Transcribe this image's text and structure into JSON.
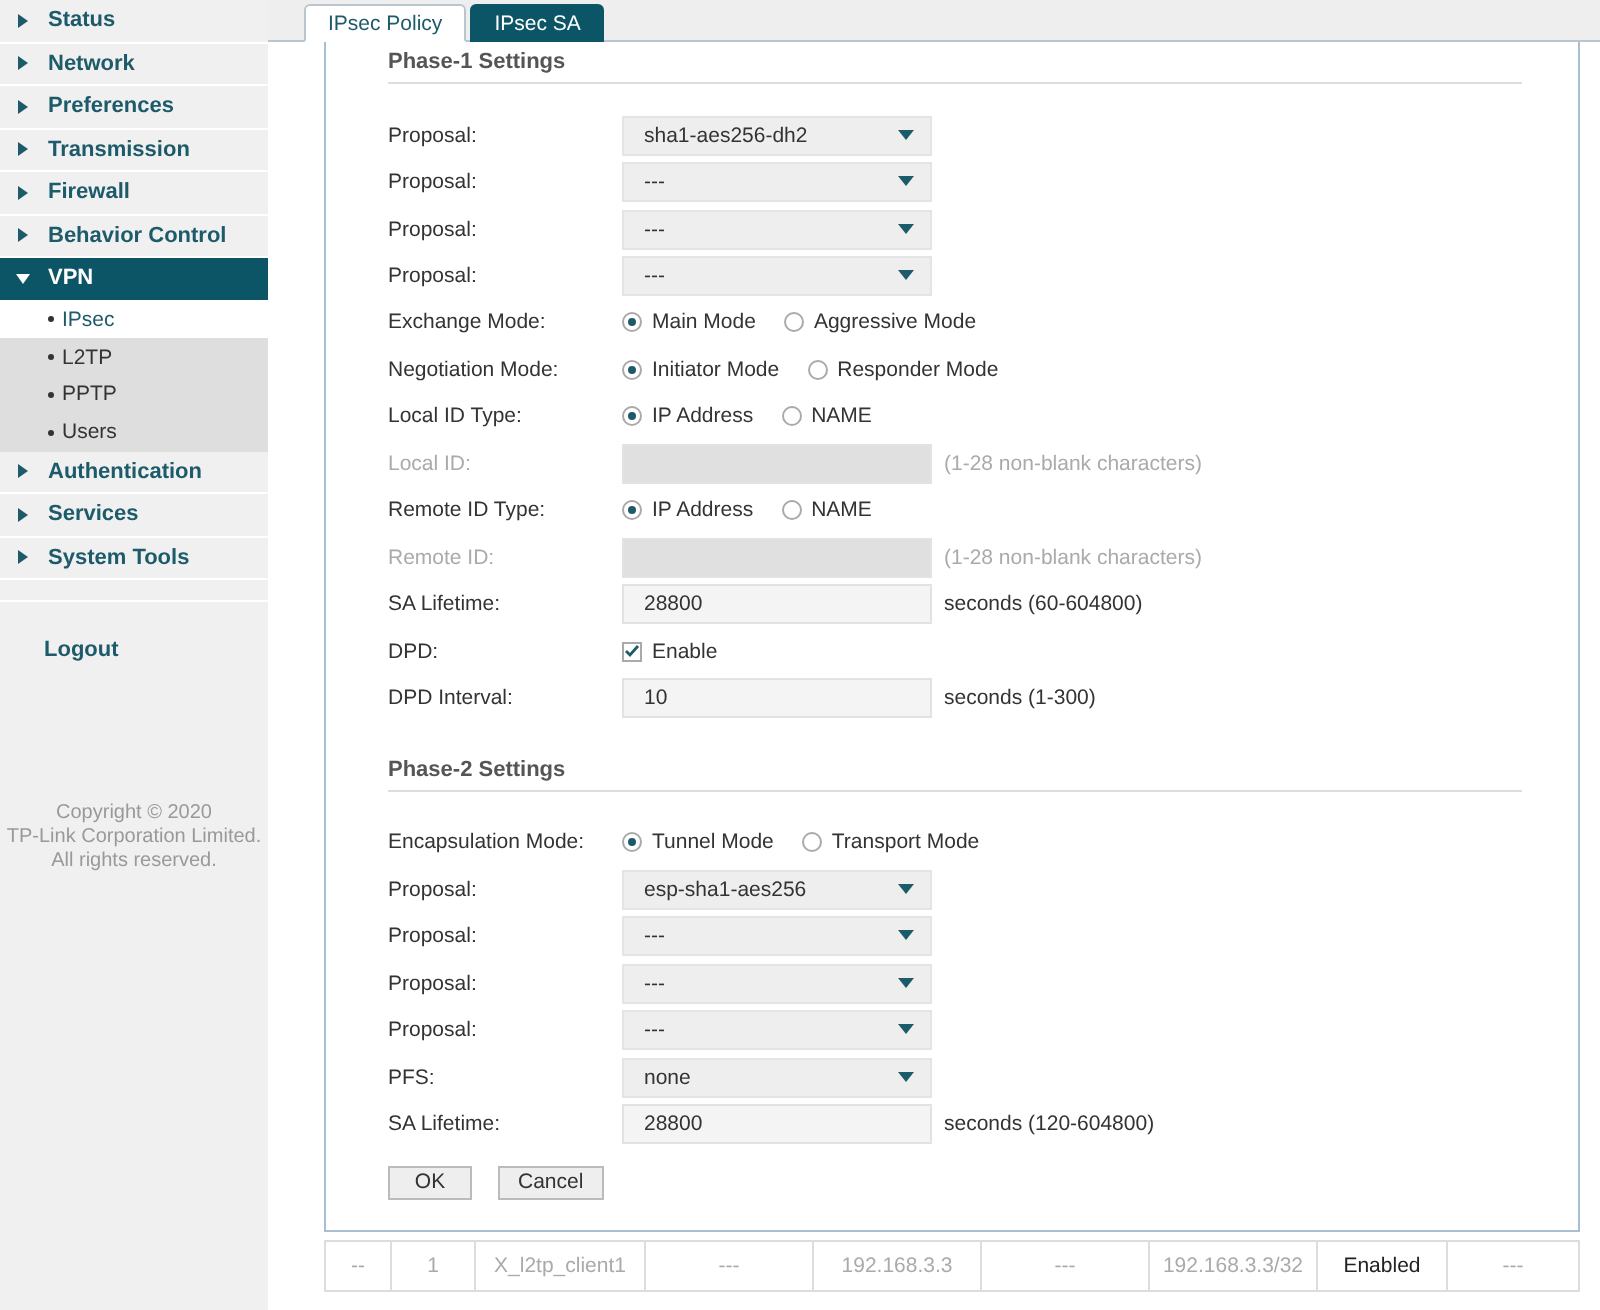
{
  "sidebar": {
    "items": [
      {
        "label": "Status",
        "expanded": false,
        "selected": false
      },
      {
        "label": "Network",
        "expanded": false,
        "selected": false
      },
      {
        "label": "Preferences",
        "expanded": false,
        "selected": false
      },
      {
        "label": "Transmission",
        "expanded": false,
        "selected": false
      },
      {
        "label": "Firewall",
        "expanded": false,
        "selected": false
      },
      {
        "label": "Behavior Control",
        "expanded": false,
        "selected": false
      },
      {
        "label": "VPN",
        "expanded": true,
        "selected": true,
        "children": [
          {
            "label": "IPsec",
            "selected": true
          },
          {
            "label": "L2TP",
            "selected": false
          },
          {
            "label": "PPTP",
            "selected": false
          },
          {
            "label": "Users",
            "selected": false
          }
        ]
      },
      {
        "label": "Authentication",
        "expanded": false,
        "selected": false
      },
      {
        "label": "Services",
        "expanded": false,
        "selected": false
      },
      {
        "label": "System Tools",
        "expanded": false,
        "selected": false
      }
    ],
    "logout": "Logout",
    "copyright": [
      "Copyright © 2020",
      "TP-Link Corporation Limited.",
      "All rights reserved."
    ]
  },
  "tabs": [
    {
      "label": "IPsec Policy",
      "selected": true
    },
    {
      "label": "IPsec SA",
      "selected": false
    }
  ],
  "sections": [
    {
      "title": "Phase-1 Settings",
      "rows": [
        {
          "kind": "select",
          "label": "Proposal:",
          "value": "sha1-aes256-dh2"
        },
        {
          "kind": "select",
          "label": "Proposal:",
          "value": "---"
        },
        {
          "kind": "select",
          "label": "Proposal:",
          "value": "---"
        },
        {
          "kind": "select",
          "label": "Proposal:",
          "value": "---"
        },
        {
          "kind": "radio",
          "label": "Exchange Mode:",
          "options": [
            {
              "label": "Main Mode",
              "selected": true
            },
            {
              "label": "Aggressive Mode",
              "selected": false
            }
          ]
        },
        {
          "kind": "radio",
          "label": "Negotiation Mode:",
          "options": [
            {
              "label": "Initiator Mode",
              "selected": true
            },
            {
              "label": "Responder Mode",
              "selected": false
            }
          ]
        },
        {
          "kind": "radio",
          "label": "Local ID Type:",
          "options": [
            {
              "label": "IP Address",
              "selected": true
            },
            {
              "label": "NAME",
              "selected": false
            }
          ]
        },
        {
          "kind": "text",
          "label": "Local ID:",
          "disabled": true,
          "hint": "(1-28 non-blank characters)"
        },
        {
          "kind": "radio",
          "label": "Remote ID Type:",
          "options": [
            {
              "label": "IP Address",
              "selected": true
            },
            {
              "label": "NAME",
              "selected": false
            }
          ]
        },
        {
          "kind": "text",
          "label": "Remote ID:",
          "disabled": true,
          "hint": "(1-28 non-blank characters)"
        },
        {
          "kind": "text",
          "label": "SA Lifetime:",
          "disabled": false,
          "value": "28800",
          "hint": "seconds (60-604800)"
        },
        {
          "kind": "checkbox",
          "label": "DPD:",
          "option": "Enable",
          "checked": true
        },
        {
          "kind": "text",
          "label": "DPD Interval:",
          "disabled": false,
          "value": "10",
          "hint": "seconds (1-300)"
        }
      ]
    },
    {
      "title": "Phase-2 Settings",
      "rows": [
        {
          "kind": "radio",
          "label": "Encapsulation Mode:",
          "options": [
            {
              "label": "Tunnel Mode",
              "selected": true
            },
            {
              "label": "Transport Mode",
              "selected": false
            }
          ]
        },
        {
          "kind": "select",
          "label": "Proposal:",
          "value": "esp-sha1-aes256"
        },
        {
          "kind": "select",
          "label": "Proposal:",
          "value": "---"
        },
        {
          "kind": "select",
          "label": "Proposal:",
          "value": "---"
        },
        {
          "kind": "select",
          "label": "Proposal:",
          "value": "---"
        },
        {
          "kind": "select",
          "label": "PFS:",
          "value": "none"
        },
        {
          "kind": "text",
          "label": "SA Lifetime:",
          "disabled": false,
          "value": "28800",
          "hint": "seconds (120-604800)"
        }
      ]
    }
  ],
  "buttons": [
    "OK",
    "Cancel"
  ],
  "table": {
    "rows": [
      {
        "cells": [
          {
            "text": "--",
            "kind": "plain"
          },
          {
            "text": "1",
            "kind": "plain"
          },
          {
            "text": "X_l2tp_client1",
            "kind": "plain"
          },
          {
            "text": "---",
            "kind": "plain"
          },
          {
            "text": "192.168.3.3",
            "kind": "plain"
          },
          {
            "text": "---",
            "kind": "plain"
          },
          {
            "text": "192.168.3.3/32",
            "kind": "plain"
          },
          {
            "text": "Enabled",
            "kind": "status"
          },
          {
            "text": "---",
            "kind": "plain"
          }
        ]
      }
    ]
  }
}
